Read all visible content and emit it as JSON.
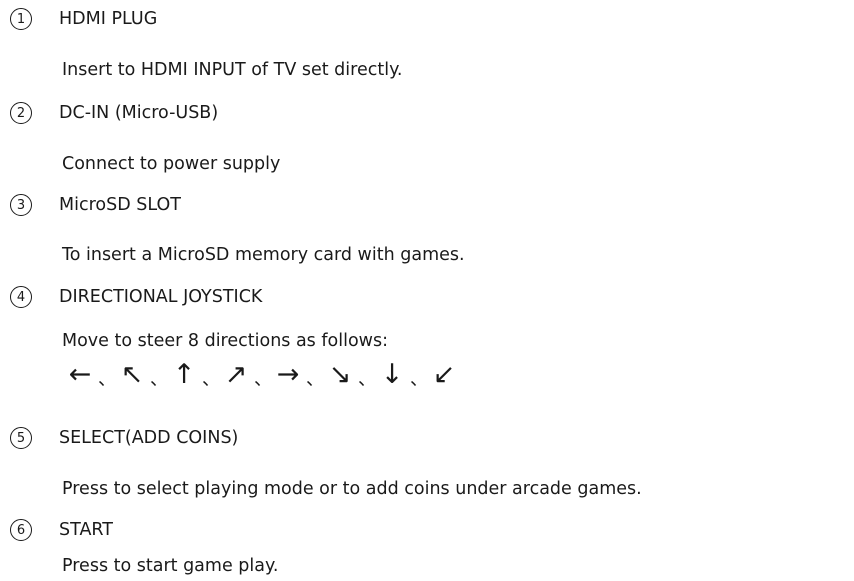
{
  "items": [
    {
      "num": "1",
      "title": "HDMI PLUG",
      "desc": "Insert to HDMI INPUT of TV set directly."
    },
    {
      "num": "2",
      "title": "DC-IN (Micro-USB)",
      "desc": "Connect to power supply"
    },
    {
      "num": "3",
      "title": "MicroSD SLOT",
      "desc": "To insert a MicroSD memory card with games."
    },
    {
      "num": "4",
      "title": "DIRECTIONAL JOYSTICK",
      "desc": "Move to steer 8 directions as follows:"
    },
    {
      "num": "5",
      "title": "SELECT(ADD COINS)",
      "desc": "Press to select playing mode or to add coins under arcade games."
    },
    {
      "num": "6",
      "title": "START",
      "desc": "Press to start game play."
    }
  ],
  "arrows": {
    "glyphs": [
      "←",
      "↖",
      "↑",
      "↗",
      "→",
      "↘",
      "↓",
      "↙"
    ],
    "separator": "、"
  }
}
